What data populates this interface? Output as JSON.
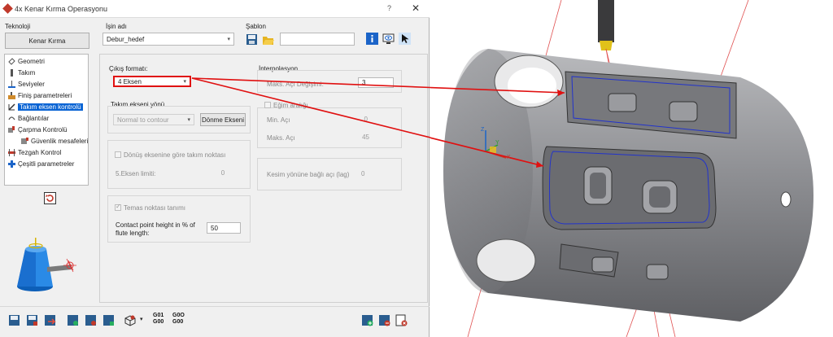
{
  "window": {
    "title": "4x Kenar Kırma Operasyonu",
    "help": "?",
    "close": "✕"
  },
  "technology": {
    "label": "Teknoloji",
    "button": "Kenar Kırma"
  },
  "job_name": {
    "label": "İşin adı",
    "value": "Debur_hedef"
  },
  "template": {
    "label": "Şablon"
  },
  "tree": {
    "items": [
      {
        "label": "Geometri",
        "icon": "geometry-icon"
      },
      {
        "label": "Takım",
        "icon": "tool-icon"
      },
      {
        "label": "Seviyeler",
        "icon": "levels-icon"
      },
      {
        "label": "Finiş parametreleri",
        "icon": "finish-params-icon"
      },
      {
        "label": "Takım eksen kontrolü",
        "icon": "tool-axis-control-icon"
      },
      {
        "label": "Bağlantılar",
        "icon": "links-icon"
      },
      {
        "label": "Çarpma Kontrolü",
        "icon": "collision-control-icon"
      },
      {
        "label": "Güvenlik mesafeleri",
        "icon": "safety-distance-icon"
      },
      {
        "label": "Tezgah Kontrol",
        "icon": "machine-control-icon"
      },
      {
        "label": "Çeşitli parametreler",
        "icon": "misc-params-icon"
      }
    ],
    "selected_index": 4
  },
  "output_format": {
    "label": "Çıkış formatı:",
    "value": "4 Eksen"
  },
  "tool_axis_direction": {
    "label": "Takım ekseni yönü",
    "value": "Normal to contour",
    "button": "Dönme Ekseni"
  },
  "rotate_tool_point": {
    "label": "Dönüş eksenine göre takım noktası",
    "checked": false
  },
  "axis_limit": {
    "label": "5.Eksen limiti:",
    "value": "0"
  },
  "contact_point": {
    "label": "Temas noktası tanımı",
    "checked": true,
    "height_label_line1": "Contact point height in % of",
    "height_label_line2": "flute length:",
    "height_value": "50"
  },
  "interpolation": {
    "label": "İnterpolasyon",
    "max_angle_label": "Maks. Açı Değişimi:",
    "max_angle_value": "3"
  },
  "tilt_range": {
    "label": "Eğim aralığı",
    "checked": false,
    "min_label": "Min. Açı",
    "min_value": "0",
    "max_label": "Maks. Açı",
    "max_value": "45"
  },
  "cut_direction": {
    "label": "Kesim yönüne bağlı açı (lag)",
    "value": "0"
  },
  "bottom_toolbar": {
    "g01_top": "G01",
    "g01_bottom": "G00",
    "g0c_top": "G0O",
    "g0c_bottom": "G00"
  },
  "axis_triad": {
    "x": "X",
    "y": "Y",
    "z": "Z"
  },
  "colors": {
    "accent": "#0a64d4",
    "callout": "#e01010",
    "part": "#8e8f93",
    "toolpath": "#2233cc"
  }
}
